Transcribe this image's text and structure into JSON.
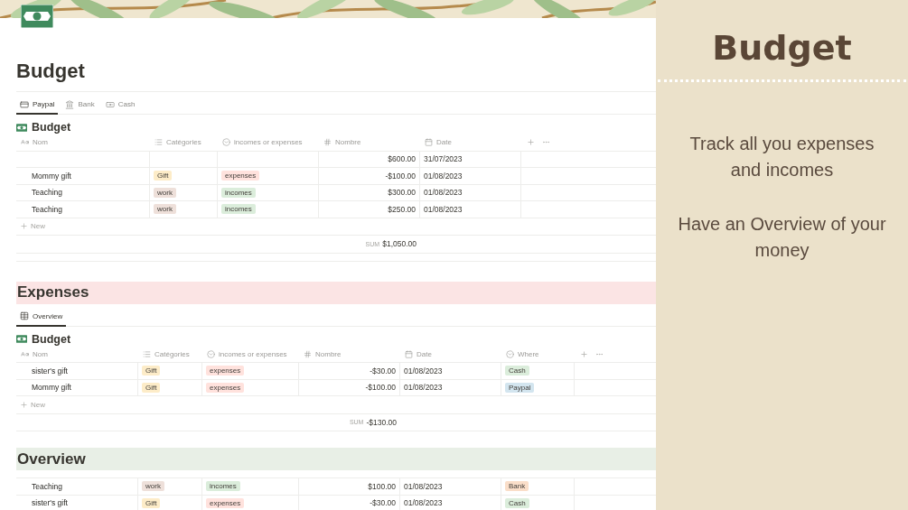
{
  "page_title": "Budget",
  "tabs": [
    {
      "label": "Paypal",
      "kind": "card",
      "selected": true
    },
    {
      "label": "Bank",
      "kind": "bank",
      "selected": false
    },
    {
      "label": "Cash",
      "kind": "cash",
      "selected": false
    }
  ],
  "paypal_table": {
    "title": "Budget",
    "columns": [
      {
        "label": "Nom",
        "kind": "title"
      },
      {
        "label": "Catégories",
        "kind": "multi"
      },
      {
        "label": "incomes or expenses",
        "kind": "select"
      },
      {
        "label": "Nombre",
        "kind": "number"
      },
      {
        "label": "Date",
        "kind": "date"
      }
    ],
    "rows": [
      [
        null,
        null,
        null,
        "$600.00",
        "31/07/2023"
      ],
      [
        "Mommy gift",
        {
          "text": "Gift",
          "color": "#fdecc8"
        },
        {
          "text": "expenses",
          "color": "#ffe2dd"
        },
        "-$100.00",
        "01/08/2023"
      ],
      [
        "Teaching",
        {
          "text": "work",
          "color": "#eee0da"
        },
        {
          "text": "incomes",
          "color": "#dbeddb"
        },
        "$300.00",
        "01/08/2023"
      ],
      [
        "Teaching",
        {
          "text": "work",
          "color": "#eee0da"
        },
        {
          "text": "incomes",
          "color": "#dbeddb"
        },
        "$250.00",
        "01/08/2023"
      ]
    ],
    "new_label": "New",
    "sum": {
      "label": "SUM",
      "value": "$1,050.00"
    }
  },
  "sections": [
    {
      "heading": "Expenses",
      "color": "#fbe4e4",
      "tabs": [
        {
          "label": "Overview",
          "kind": "table",
          "selected": true
        }
      ],
      "table": {
        "title": "Budget",
        "columns": [
          {
            "label": "Nom",
            "kind": "title"
          },
          {
            "label": "Catégories",
            "kind": "multi"
          },
          {
            "label": "incomes or expenses",
            "kind": "select"
          },
          {
            "label": "Nombre",
            "kind": "number"
          },
          {
            "label": "Date",
            "kind": "date"
          },
          {
            "label": "Where",
            "kind": "select"
          }
        ],
        "rows": [
          [
            "sister's gift",
            {
              "text": "Gift",
              "color": "#fdecc8"
            },
            {
              "text": "expenses",
              "color": "#ffe2dd"
            },
            "-$30.00",
            "01/08/2023",
            {
              "text": "Cash",
              "color": "#dbeddb"
            }
          ],
          [
            "Mommy gift",
            {
              "text": "Gift",
              "color": "#fdecc8"
            },
            {
              "text": "expenses",
              "color": "#ffe2dd"
            },
            "-$100.00",
            "01/08/2023",
            {
              "text": "Paypal",
              "color": "#d3e5ef"
            }
          ]
        ],
        "new_label": "New",
        "sum": {
          "label": "SUM",
          "value": "-$130.00"
        }
      }
    },
    {
      "heading": "Overview",
      "color": "#e8efe6",
      "table": {
        "rows": [
          [
            "Teaching",
            {
              "text": "work",
              "color": "#eee0da"
            },
            {
              "text": "incomes",
              "color": "#dbeddb"
            },
            "$100.00",
            "01/08/2023",
            {
              "text": "Bank",
              "color": "#fadec9"
            }
          ],
          [
            "sister's gift",
            {
              "text": "Gift",
              "color": "#fdecc8"
            },
            {
              "text": "expenses",
              "color": "#ffe2dd"
            },
            "-$30.00",
            "01/08/2023",
            {
              "text": "Cash",
              "color": "#dbeddb"
            }
          ]
        ]
      }
    }
  ],
  "aside": {
    "title": "Budget",
    "paragraphs": [
      "Track all you expenses and incomes",
      "Have an Overview of your money"
    ]
  }
}
